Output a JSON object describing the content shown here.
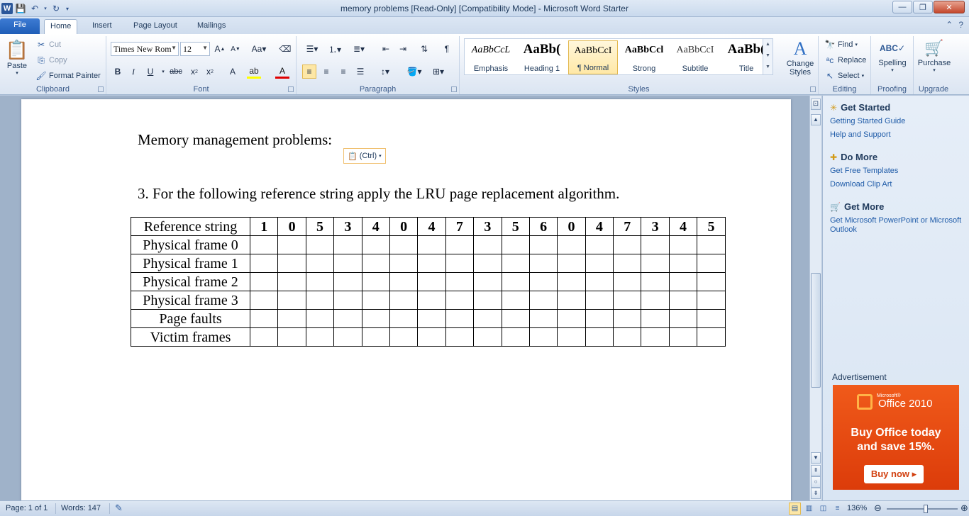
{
  "window": {
    "title": "memory problems [Read-Only] [Compatibility Mode]  -  Microsoft Word Starter",
    "logo_letter": "W",
    "controls": {
      "minimize": "—",
      "restore": "❐",
      "close": "✕"
    }
  },
  "tabs": [
    {
      "label": "File"
    },
    {
      "label": "Home"
    },
    {
      "label": "Insert"
    },
    {
      "label": "Page Layout"
    },
    {
      "label": "Mailings"
    }
  ],
  "ribbon": {
    "clipboard": {
      "label": "Clipboard",
      "paste": "Paste",
      "cut": "Cut",
      "copy": "Copy",
      "format_painter": "Format Painter"
    },
    "font": {
      "label": "Font",
      "font_name": "Times New Rom",
      "font_size": "12"
    },
    "paragraph": {
      "label": "Paragraph"
    },
    "styles": {
      "label": "Styles",
      "items": [
        {
          "sample": "AaBbCcL",
          "name": "Emphasis"
        },
        {
          "sample": "AaBb(",
          "name": "Heading 1"
        },
        {
          "sample": "AaBbCcI",
          "name": "¶ Normal"
        },
        {
          "sample": "AaBbCcl",
          "name": "Strong"
        },
        {
          "sample": "AaBbCcI",
          "name": "Subtitle"
        },
        {
          "sample": "AaBb(",
          "name": "Title"
        }
      ],
      "change_styles_line1": "Change",
      "change_styles_line2": "Styles"
    },
    "editing": {
      "label": "Editing",
      "find": "Find",
      "replace": "Replace",
      "select": "Select"
    },
    "proofing": {
      "label": "Proofing",
      "spelling": "Spelling"
    },
    "upgrade": {
      "label": "Upgrade",
      "purchase": "Purchase"
    }
  },
  "document": {
    "heading": "Memory management problems:",
    "paste_options": "(Ctrl)",
    "question": "3. For the following reference string apply the LRU page replacement algorithm.",
    "table": {
      "reference_label": "Reference string",
      "reference_values": [
        "1",
        "0",
        "5",
        "3",
        "4",
        "0",
        "4",
        "7",
        "3",
        "5",
        "6",
        "0",
        "4",
        "7",
        "3",
        "4",
        "5"
      ],
      "row_labels": [
        "Physical frame 0",
        "Physical frame 1",
        "Physical frame 2",
        "Physical frame 3",
        "Page faults",
        "Victim frames"
      ]
    }
  },
  "taskpane": {
    "get_started": {
      "title": "Get Started",
      "links": [
        "Getting Started Guide",
        "Help and Support"
      ]
    },
    "do_more": {
      "title": "Do More",
      "links": [
        "Get Free Templates",
        "Download Clip Art"
      ]
    },
    "get_more": {
      "title": "Get More",
      "links": [
        "Get Microsoft PowerPoint or Microsoft Outlook"
      ]
    },
    "ad_label": "Advertisement",
    "ad": {
      "brand_small": "Microsoft®",
      "brand": "Office 2010",
      "headline_line1": "Buy Office today",
      "headline_line2": "and save 15%.",
      "button": "Buy now ▸"
    }
  },
  "statusbar": {
    "page": "Page: 1 of 1",
    "words": "Words: 147",
    "zoom": "136%",
    "zoom_level_percent": 136
  }
}
